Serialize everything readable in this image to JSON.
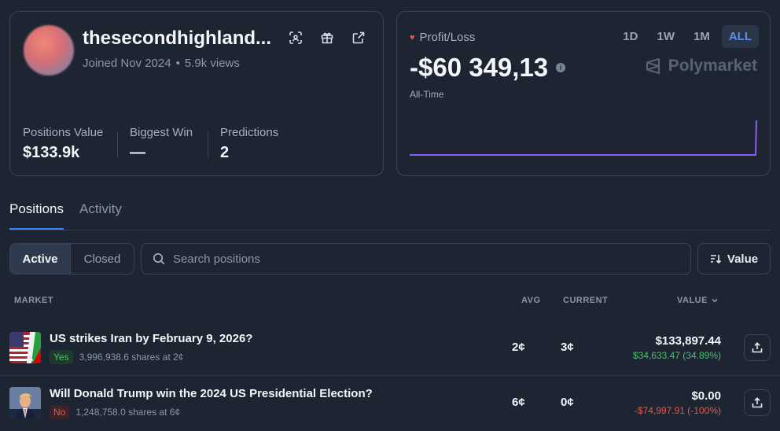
{
  "profile": {
    "username": "thesecondhighland...",
    "joined": "Joined Nov 2024",
    "views": "5.9k views",
    "stats": [
      {
        "label": "Positions Value",
        "value": "$133.9k"
      },
      {
        "label": "Biggest Win",
        "value": "—"
      },
      {
        "label": "Predictions",
        "value": "2"
      }
    ],
    "icons": [
      "qr-scan-icon",
      "gift-icon",
      "external-link-icon"
    ]
  },
  "pnl": {
    "label": "Profit/Loss",
    "value": "-$60 349,13",
    "period_label": "All-Time",
    "ranges": [
      "1D",
      "1W",
      "1M",
      "ALL"
    ],
    "active_range": "ALL",
    "brand": "Polymarket",
    "line_color": "#8b5cf6"
  },
  "tabs": {
    "positions": "Positions",
    "activity": "Activity",
    "active": "Positions"
  },
  "filters": {
    "active_label": "Active",
    "closed_label": "Closed",
    "search_placeholder": "Search positions",
    "sort_label": "Value"
  },
  "table": {
    "headers": {
      "market": "MARKET",
      "avg": "AVG",
      "current": "CURRENT",
      "value": "VALUE"
    },
    "rows": [
      {
        "title": "US strikes Iran by February 9, 2026?",
        "outcome": "Yes",
        "shares": "3,996,938.6 shares at 2¢",
        "avg": "2¢",
        "current": "3¢",
        "value": "$133,897.44",
        "pnl": "$34,633.47 (34.89%)",
        "image": "us-iran-flags"
      },
      {
        "title": "Will Donald Trump win the 2024 US Presidential Election?",
        "outcome": "No",
        "shares": "1,248,758.0 shares at 6¢",
        "avg": "6¢",
        "current": "0¢",
        "value": "$0.00",
        "pnl": "-$74,997.91 (-100%)",
        "image": "trump-portrait"
      }
    ]
  },
  "colors": {
    "accent": "#3b82f6",
    "positive": "#4cc070",
    "negative": "#e05a4f",
    "background": "#1d2533"
  }
}
